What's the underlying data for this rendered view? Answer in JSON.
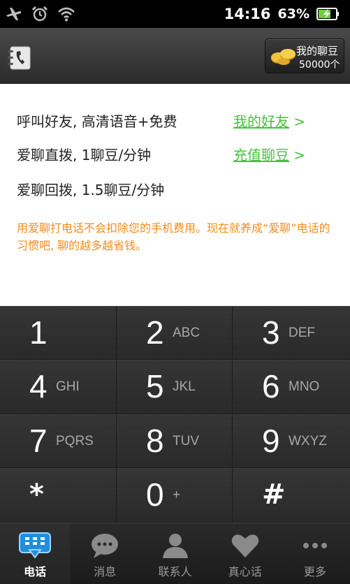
{
  "status_bar": {
    "time": "14:16",
    "battery_percent": "63%",
    "icons": [
      "airplane-icon",
      "alarm-icon",
      "wifi-icon",
      "battery-charging-icon"
    ]
  },
  "top_bar": {
    "contacts_icon": "contacts-book-icon",
    "beans_button": {
      "title": "我的聊豆",
      "count": "50000个",
      "icon": "coins-icon"
    }
  },
  "info": {
    "lines": [
      "呼叫好友, 高清语音+免费",
      "爱聊直拨, 1聊豆/分钟",
      "爱聊回拨, 1.5聊豆/分钟"
    ],
    "links": [
      {
        "label": "我的好友",
        "arrow": ">"
      },
      {
        "label": "充值聊豆",
        "arrow": ">"
      }
    ],
    "notice": "用爱聊打电话不会扣除您的手机费用。现在就养成“爱聊”电话的习惯吧, 聊的越多越省钱。"
  },
  "keypad": {
    "keys": [
      {
        "digit": "1",
        "letters": ""
      },
      {
        "digit": "2",
        "letters": "ABC"
      },
      {
        "digit": "3",
        "letters": "DEF"
      },
      {
        "digit": "4",
        "letters": "GHI"
      },
      {
        "digit": "5",
        "letters": "JKL"
      },
      {
        "digit": "6",
        "letters": "MNO"
      },
      {
        "digit": "7",
        "letters": "PQRS"
      },
      {
        "digit": "8",
        "letters": "TUV"
      },
      {
        "digit": "9",
        "letters": "WXYZ"
      },
      {
        "digit": "*",
        "letters": ""
      },
      {
        "digit": "0",
        "letters": "+"
      },
      {
        "digit": "#",
        "letters": ""
      }
    ]
  },
  "bottom_nav": {
    "tabs": [
      {
        "label": "电话",
        "icon": "dialpad-icon",
        "active": true
      },
      {
        "label": "消息",
        "icon": "chat-bubble-icon",
        "active": false
      },
      {
        "label": "联系人",
        "icon": "person-icon",
        "active": false
      },
      {
        "label": "真心话",
        "icon": "heart-icon",
        "active": false
      },
      {
        "label": "更多",
        "icon": "more-dots-icon",
        "active": false
      }
    ]
  },
  "colors": {
    "link_green": "#43c43a",
    "notice_orange": "#f08c1e",
    "keypad_bg": "#2d2d2d",
    "accent_blue": "#1e8fe0"
  }
}
